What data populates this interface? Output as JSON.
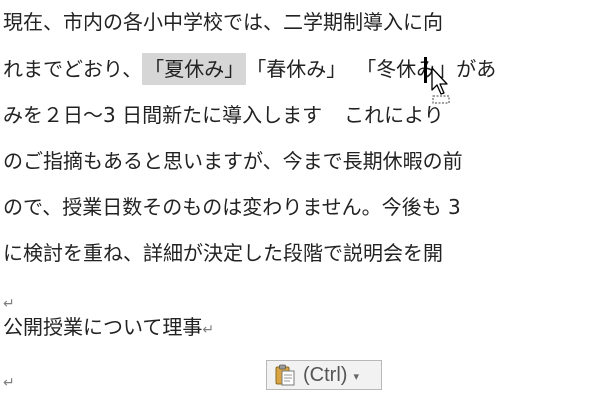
{
  "document": {
    "line1": "現在、市内の各小中学校では、二学期制導入に向",
    "line2_before": "れまでどおり、",
    "line2_selected": "「夏休み」",
    "line2_after_a": "「春休み」",
    "line2_after_b": "「冬休み」があ",
    "line3": "みを２日～3 日間新たに導入します",
    "line3_tail": "これにより",
    "line4": "のご指摘もあると思いますが、今まで長期休暇の前",
    "line5": "ので、授業日数そのものは変わりません。今後も 3",
    "line6": "に検討を重ね、詳細が決定した段階で説明会を開",
    "paragraph_mark": "↵",
    "heading": "公開授業について理事"
  },
  "paste_options": {
    "label": "(Ctrl)",
    "dropdown_arrow": "▾",
    "icon": "clipboard-icon"
  },
  "colors": {
    "selection": "#d6d6d6",
    "text": "#222222",
    "paragraph_mark": "#7f7f7f"
  }
}
